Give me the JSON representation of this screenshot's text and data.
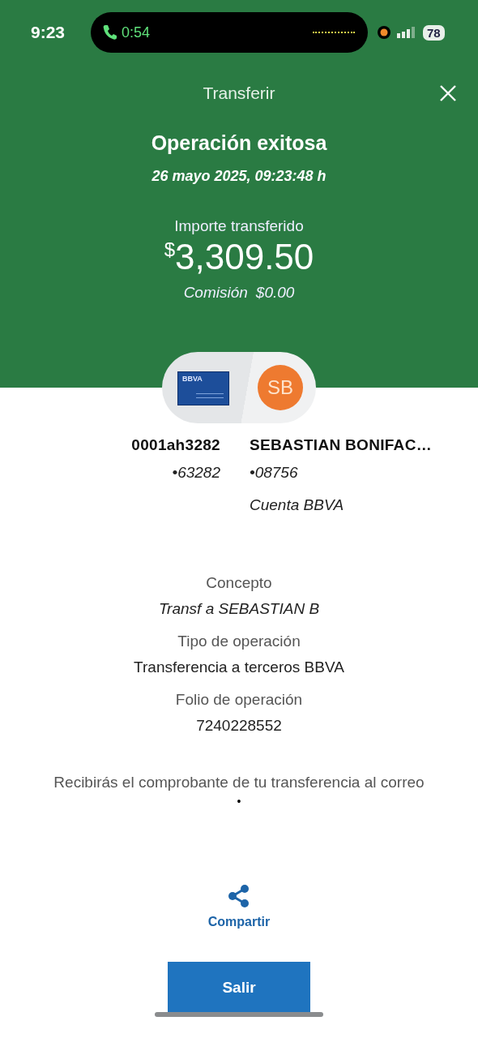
{
  "status_bar": {
    "time": "9:23",
    "call_duration": "0:54",
    "battery": "78"
  },
  "header": {
    "title": "Transferir",
    "status": "Operación exitosa",
    "datetime": "26 mayo 2025, 09:23:48 h",
    "amount_label": "Importe transferido",
    "currency": "$",
    "amount": "3,309.50",
    "commission_label": "Comisión",
    "commission": "$0.00"
  },
  "origin": {
    "card_brand": "BBVA",
    "name": "0001ah3282",
    "account": "•63282"
  },
  "destination": {
    "initials": "SB",
    "name": "SEBASTIAN BONIFAC…",
    "account": "•08756",
    "bank": "Cuenta BBVA"
  },
  "details": [
    {
      "label": "Concepto",
      "value": "Transf a SEBASTIAN B",
      "kind": "italic"
    },
    {
      "label": "Tipo de operación",
      "value": "Transferencia a terceros BBVA",
      "kind": "plain"
    },
    {
      "label": "Folio de operación",
      "value": "7240228552",
      "kind": "plain"
    }
  ],
  "notice": "Recibirás el comprobante de tu transferencia al correo",
  "email": "•",
  "share": "Compartir",
  "exit": "Salir"
}
